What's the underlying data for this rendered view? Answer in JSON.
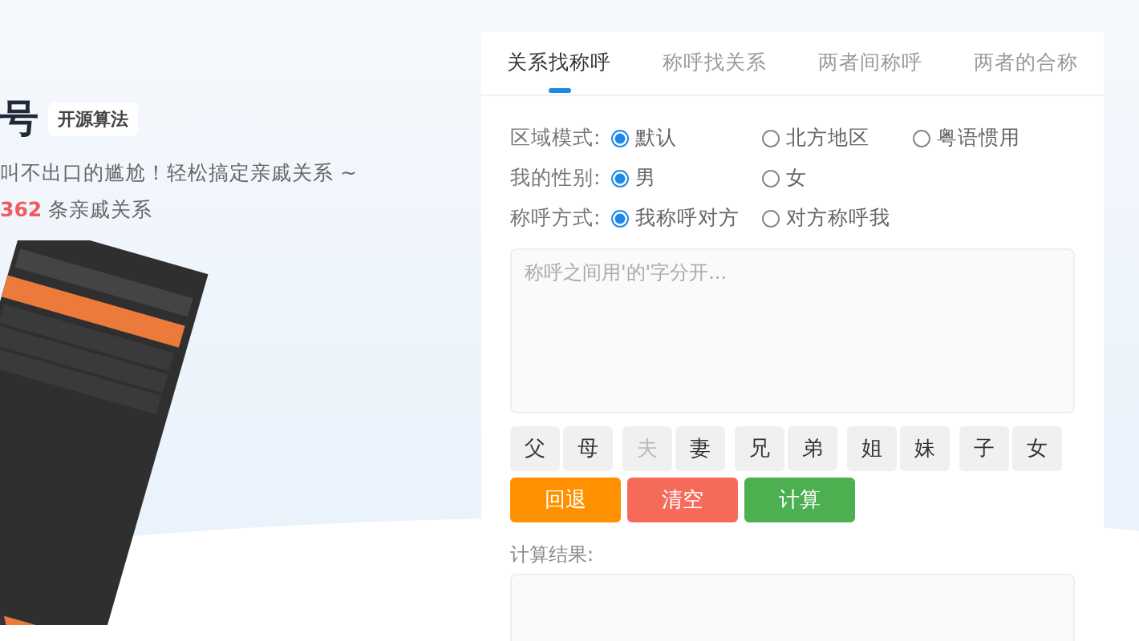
{
  "hero": {
    "title": "号",
    "badge": "开源算法",
    "tagline": "叫不出口的尴尬！轻松搞定亲戚关系 ~",
    "count": "362",
    "count_suffix": "条亲戚关系"
  },
  "tabs": [
    {
      "label": "关系找称呼",
      "selected": true
    },
    {
      "label": "称呼找关系",
      "selected": false
    },
    {
      "label": "两者间称呼",
      "selected": false
    },
    {
      "label": "两者的合称",
      "selected": false
    }
  ],
  "options": [
    {
      "label": "区域模式:",
      "choices": [
        {
          "label": "默认",
          "selected": true
        },
        {
          "label": "北方地区",
          "selected": false
        },
        {
          "label": "粤语惯用",
          "selected": false
        }
      ]
    },
    {
      "label": "我的性别:",
      "choices": [
        {
          "label": "男",
          "selected": true
        },
        {
          "label": "女",
          "selected": false
        }
      ]
    },
    {
      "label": "称呼方式:",
      "choices": [
        {
          "label": "我称呼对方",
          "selected": true
        },
        {
          "label": "对方称呼我",
          "selected": false
        }
      ]
    }
  ],
  "input": {
    "placeholder": "称呼之间用'的'字分开..."
  },
  "keys": [
    {
      "label": "父",
      "disabled": false
    },
    {
      "label": "母",
      "disabled": false
    },
    {
      "label": "夫",
      "disabled": true
    },
    {
      "label": "妻",
      "disabled": false
    },
    {
      "label": "兄",
      "disabled": false
    },
    {
      "label": "弟",
      "disabled": false
    },
    {
      "label": "姐",
      "disabled": false
    },
    {
      "label": "妹",
      "disabled": false
    },
    {
      "label": "子",
      "disabled": false
    },
    {
      "label": "女",
      "disabled": false
    }
  ],
  "actions": [
    {
      "label": "回退",
      "color": "#ff9100"
    },
    {
      "label": "清空",
      "color": "#f66a5a"
    },
    {
      "label": "计算",
      "color": "#4caf50"
    }
  ],
  "result": {
    "label": "计算结果:"
  }
}
